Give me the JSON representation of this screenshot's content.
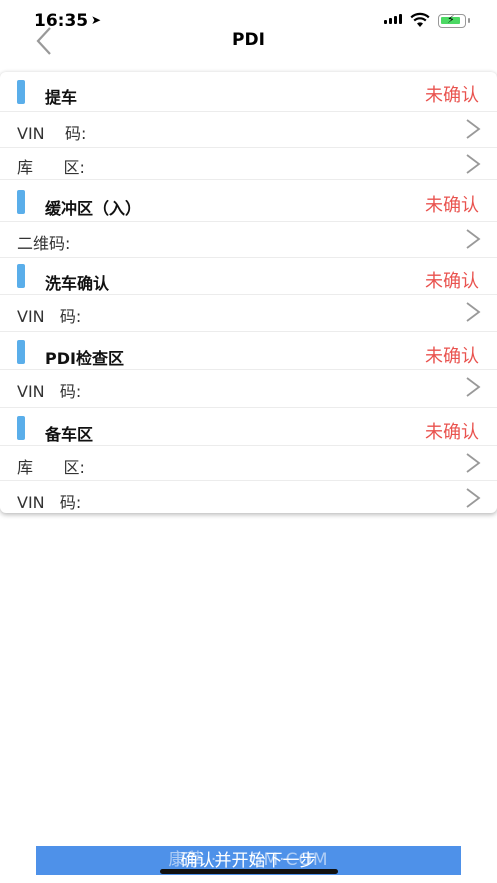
{
  "status_bar": {
    "time": "16:35",
    "location_icon": "location-arrow-icon",
    "signal_icon": "cell-signal-icon",
    "wifi_icon": "wifi-icon",
    "battery_icon": "battery-charging-icon",
    "battery_color": "#4cd964"
  },
  "nav": {
    "title": "PDI",
    "back_icon": "chevron-left-icon"
  },
  "sections": [
    {
      "title": "提车",
      "status": "未确认",
      "fields": [
        {
          "label": "VIN    码:"
        },
        {
          "label": "库      区:"
        }
      ]
    },
    {
      "title": "缓冲区（入）",
      "status": "未确认",
      "fields": [
        {
          "label": "二维码:"
        }
      ]
    },
    {
      "title": "洗车确认",
      "status": "未确认",
      "fields": [
        {
          "label": "VIN   码:"
        }
      ]
    },
    {
      "title": "PDI检查区",
      "status": "未确认",
      "fields": [
        {
          "label": "VIN   码:"
        }
      ]
    },
    {
      "title": "备车区",
      "status": "未确认",
      "fields": [
        {
          "label": "库      区:"
        },
        {
          "label": "VIN   码:"
        }
      ]
    }
  ],
  "colors": {
    "accent_bar": "#5aaeea",
    "status_text": "#e9534f",
    "button_bg": "#4e91e9"
  },
  "footer": {
    "confirm_button_label": "确认并开始下一步",
    "watermark": "康莘 · · · GM·COM"
  }
}
